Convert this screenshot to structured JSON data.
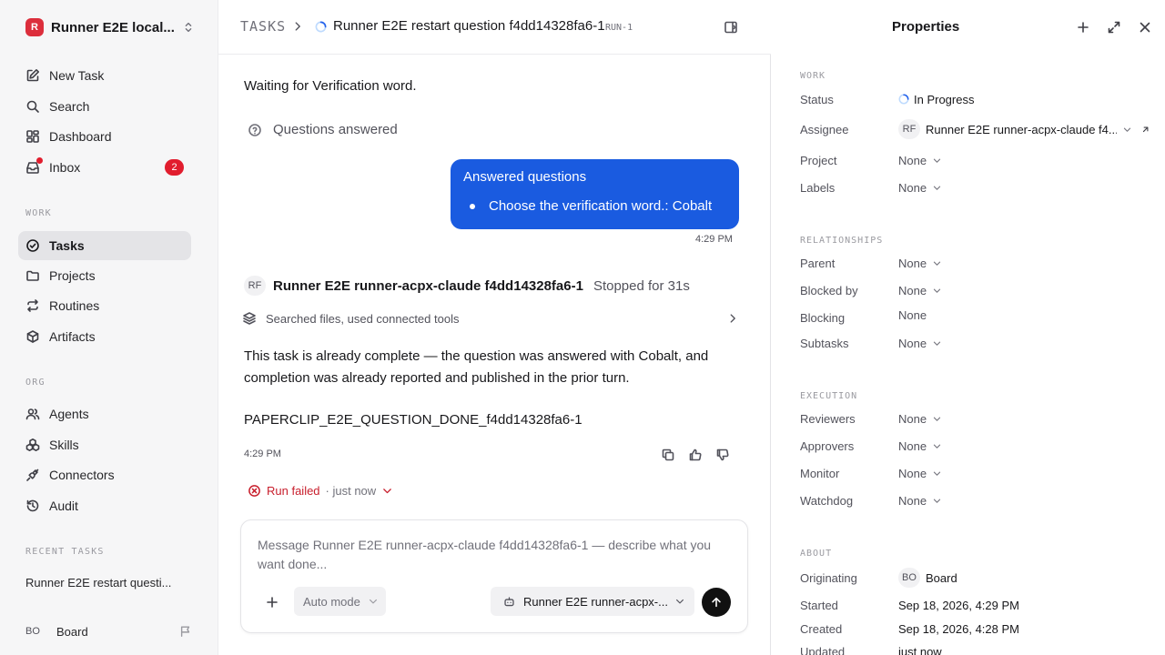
{
  "workspace": {
    "logo_letter": "R",
    "name": "Runner E2E local..."
  },
  "sidebar": {
    "top_items": [
      {
        "label": "New Task"
      },
      {
        "label": "Search"
      },
      {
        "label": "Dashboard"
      },
      {
        "label": "Inbox",
        "badge": "2"
      }
    ],
    "work_label": "WORK",
    "work_items": [
      {
        "label": "Tasks"
      },
      {
        "label": "Projects"
      },
      {
        "label": "Routines"
      },
      {
        "label": "Artifacts"
      }
    ],
    "org_label": "ORG",
    "org_items": [
      {
        "label": "Agents"
      },
      {
        "label": "Skills"
      },
      {
        "label": "Connectors"
      },
      {
        "label": "Audit"
      }
    ],
    "recent_label": "RECENT TASKS",
    "recent_items": [
      {
        "label": "Runner E2E restart questi..."
      }
    ],
    "user": {
      "initials": "BO",
      "name": "Board"
    }
  },
  "header": {
    "breadcrumb_root": "TASKS",
    "task_title": "Runner E2E restart question f4dd14328fa6-1",
    "task_id": "RUN-1"
  },
  "thread": {
    "waiting_text": "Waiting for Verification word.",
    "questions_answered_label": "Questions answered",
    "answer_bubble": {
      "title": "Answered questions",
      "items": [
        "Choose the verification word.: Cobalt"
      ],
      "time": "4:29 PM"
    },
    "agent_message": {
      "avatar": "RF",
      "name": "Runner E2E runner-acpx-claude f4dd14328fa6-1",
      "status": "Stopped for 31s",
      "tools_summary": "Searched files, used connected tools",
      "body": "This task is already complete — the question was answered with Cobalt, and completion was already reported and published in the prior turn.",
      "marker": "PAPERCLIP_E2E_QUESTION_DONE_f4dd14328fa6-1",
      "time": "4:29 PM"
    },
    "run_status": {
      "label": "Run failed",
      "time": "· just now"
    }
  },
  "composer": {
    "placeholder": "Message Runner E2E runner-acpx-claude f4dd14328fa6-1 — describe what you want done...",
    "mode_label": "Auto mode",
    "agent_label": "Runner E2E runner-acpx-..."
  },
  "properties": {
    "title": "Properties",
    "work_label": "WORK",
    "status": {
      "key": "Status",
      "value": "In Progress"
    },
    "assignee": {
      "key": "Assignee",
      "initials": "RF",
      "value": "Runner E2E runner-acpx-claude f4..."
    },
    "project": {
      "key": "Project",
      "value": "None"
    },
    "labels": {
      "key": "Labels",
      "value": "None"
    },
    "relationships_label": "RELATIONSHIPS",
    "parent": {
      "key": "Parent",
      "value": "None"
    },
    "blocked_by": {
      "key": "Blocked by",
      "value": "None"
    },
    "blocking": {
      "key": "Blocking",
      "value": "None"
    },
    "subtasks": {
      "key": "Subtasks",
      "value": "None"
    },
    "execution_label": "EXECUTION",
    "reviewers": {
      "key": "Reviewers",
      "value": "None"
    },
    "approvers": {
      "key": "Approvers",
      "value": "None"
    },
    "monitor": {
      "key": "Monitor",
      "value": "None"
    },
    "watchdog": {
      "key": "Watchdog",
      "value": "None"
    },
    "about_label": "ABOUT",
    "originating": {
      "key": "Originating",
      "initials": "BO",
      "value": "Board"
    },
    "started": {
      "key": "Started",
      "value": "Sep 18, 2026, 4:29 PM"
    },
    "created": {
      "key": "Created",
      "value": "Sep 18, 2026, 4:28 PM"
    },
    "updated": {
      "key": "Updated",
      "value": "just now"
    }
  },
  "colors": {
    "accent_blue": "#1a5be0",
    "danger_red": "#c81e2c",
    "badge_red": "#e11d2e",
    "brand_red": "#dc2e3c",
    "sidebar_bg": "#f6f6f7"
  }
}
